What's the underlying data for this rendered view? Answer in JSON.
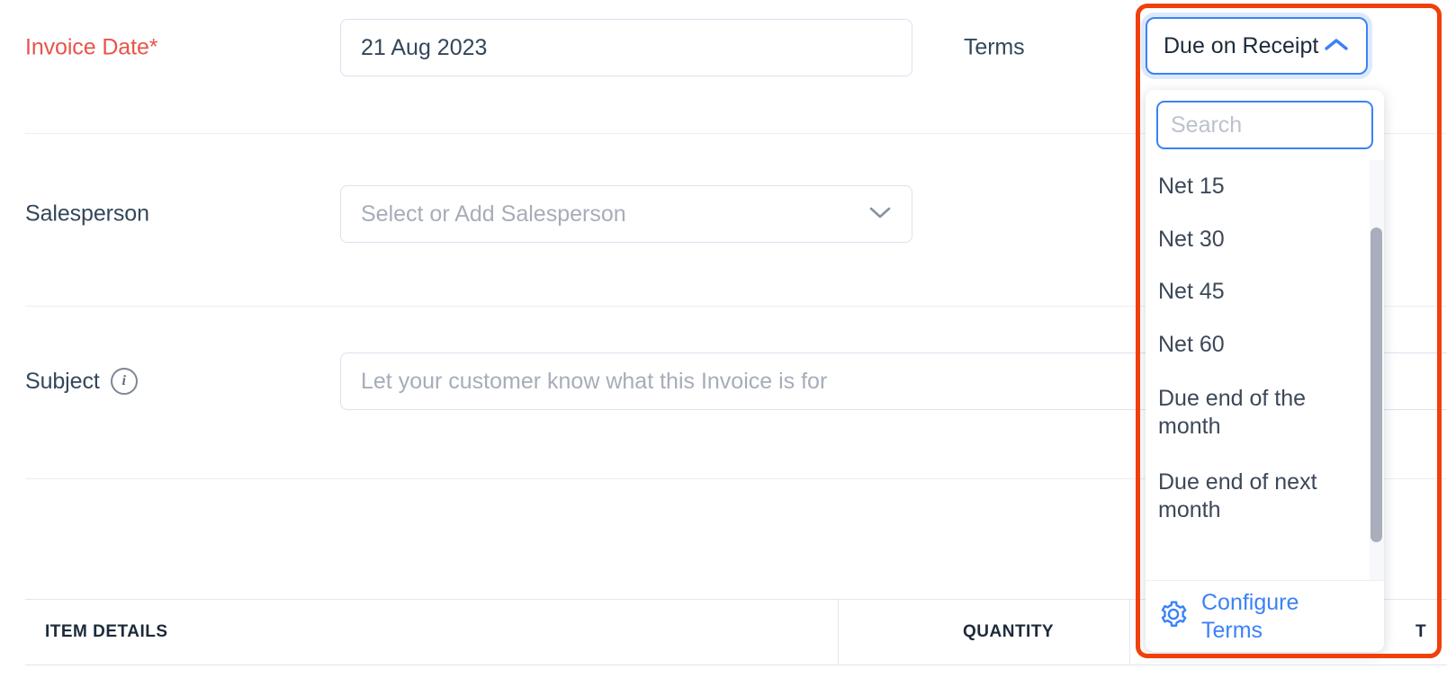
{
  "form": {
    "invoice_date": {
      "label": "Invoice Date*",
      "value": "21 Aug 2023"
    },
    "terms": {
      "label": "Terms",
      "selected": "Due on Receipt",
      "caret_icon": "chevron-up-icon",
      "search_placeholder": "Search",
      "search_value": "",
      "options": [
        "Net 15",
        "Net 30",
        "Net 45",
        "Net 60",
        "Due end of the month",
        "Due end of next month"
      ],
      "configure": {
        "icon": "gear-icon",
        "label": "Configure Terms"
      }
    },
    "salesperson": {
      "label": "Salesperson",
      "placeholder": "Select or Add Salesperson",
      "value": "",
      "caret_icon": "chevron-down-icon"
    },
    "subject": {
      "label": "Subject",
      "info_icon": "info-icon",
      "info_glyph": "i",
      "placeholder": "Let your customer know what this Invoice is for",
      "value": ""
    }
  },
  "items_table": {
    "columns": [
      "ITEM DETAILS",
      "QUANTITY",
      "T"
    ]
  },
  "colors": {
    "accent_blue": "#3b82f6",
    "required_red": "#e8544a",
    "annotation_red": "#f0400b",
    "text_dark": "#33475b",
    "placeholder_gray": "#a6adb9"
  }
}
